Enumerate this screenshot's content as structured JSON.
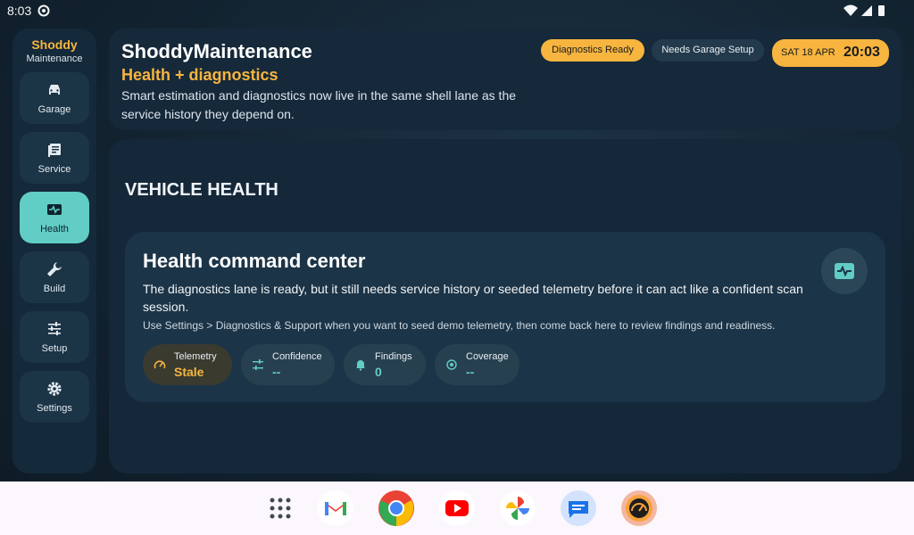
{
  "status_bar": {
    "time": "8:03"
  },
  "sidebar": {
    "brand_line1": "Shoddy",
    "brand_line2": "Maintenance",
    "items": [
      {
        "label": "Garage",
        "icon": "car-icon",
        "active": false
      },
      {
        "label": "Service",
        "icon": "service-book-icon",
        "active": false
      },
      {
        "label": "Health",
        "icon": "heart-monitor-icon",
        "active": true
      },
      {
        "label": "Build",
        "icon": "wrench-icon",
        "active": false
      },
      {
        "label": "Setup",
        "icon": "sliders-icon",
        "active": false
      },
      {
        "label": "Settings",
        "icon": "gear-icon",
        "active": false
      }
    ]
  },
  "header": {
    "app_title": "ShoddyMaintenance",
    "section_title": "Health + diagnostics",
    "description": "Smart estimation and diagnostics now live in the same shell lane as the service history they depend on.",
    "chips": {
      "diagnostics": "Diagnostics Ready",
      "garage": "Needs Garage Setup"
    },
    "date": "SAT 18 APR",
    "clock": "20:03"
  },
  "main": {
    "heading": "VEHICLE HEALTH",
    "card": {
      "title": "Health command center",
      "description": "The diagnostics lane is ready, but it still needs service history or seeded telemetry before it can act like a confident scan session.",
      "hint": "Use Settings > Diagnostics & Support when you want to seed demo telemetry, then come back here to review findings and readiness.",
      "metrics": [
        {
          "label": "Telemetry",
          "value": "Stale",
          "icon": "gauge-icon"
        },
        {
          "label": "Confidence",
          "value": "--",
          "icon": "tune-icon"
        },
        {
          "label": "Findings",
          "value": "0",
          "icon": "bell-icon"
        },
        {
          "label": "Coverage",
          "value": "--",
          "icon": "target-icon"
        }
      ]
    }
  },
  "taskbar": {
    "apps": [
      "app-drawer-icon",
      "gmail-icon",
      "chrome-icon",
      "youtube-icon",
      "photos-icon",
      "messages-icon",
      "shoddy-maintenance-icon"
    ]
  },
  "colors": {
    "accent": "#f7b53f",
    "teal": "#62cdc4",
    "background": "#12222f",
    "panel": "#16293a"
  }
}
